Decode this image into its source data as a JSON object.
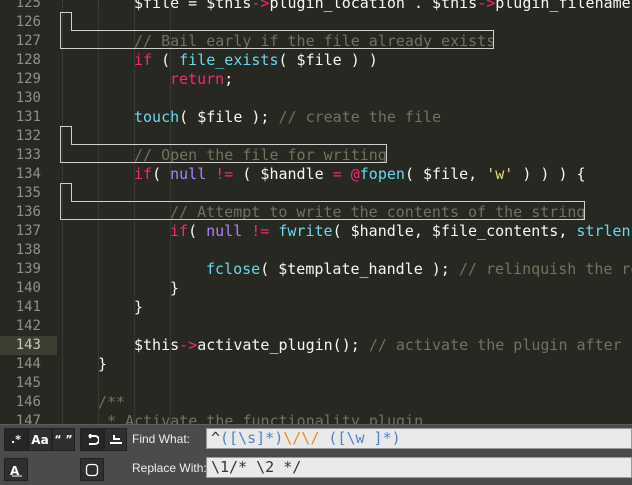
{
  "editor": {
    "first_line": 125,
    "current_line": 143,
    "colors": {
      "background": "#272822",
      "comment": "#75715e",
      "keyword": "#f92672",
      "function": "#66d9ef",
      "constant": "#ae81ff",
      "string": "#e6db74"
    },
    "lines": [
      {
        "n": "125",
        "indent": 2,
        "tokens": [
          [
            "tx",
            "$file = $this"
          ],
          [
            "op",
            "->"
          ],
          [
            "tx",
            "plugin_location . $this"
          ],
          [
            "op",
            "->"
          ],
          [
            "tx",
            "plugin_filename;"
          ]
        ]
      },
      {
        "n": "126",
        "indent": 0,
        "tokens": []
      },
      {
        "n": "127",
        "indent": 2,
        "tokens": [
          [
            "cm",
            "// Bail early if the file already exists"
          ]
        ]
      },
      {
        "n": "128",
        "indent": 2,
        "tokens": [
          [
            "kw",
            "if"
          ],
          [
            "tx",
            " ( "
          ],
          [
            "fn",
            "file_exists"
          ],
          [
            "tx",
            "( $file ) )"
          ]
        ]
      },
      {
        "n": "129",
        "indent": 3,
        "tokens": [
          [
            "kw",
            "return"
          ],
          [
            "tx",
            ";"
          ]
        ]
      },
      {
        "n": "130",
        "indent": 0,
        "tokens": []
      },
      {
        "n": "131",
        "indent": 2,
        "tokens": [
          [
            "fn",
            "touch"
          ],
          [
            "tx",
            "( $file ); "
          ],
          [
            "cm",
            "// create the file"
          ]
        ]
      },
      {
        "n": "132",
        "indent": 0,
        "tokens": []
      },
      {
        "n": "133",
        "indent": 2,
        "tokens": [
          [
            "cm",
            "// Open the file for writing"
          ]
        ]
      },
      {
        "n": "134",
        "indent": 2,
        "tokens": [
          [
            "kw",
            "if"
          ],
          [
            "tx",
            "( "
          ],
          [
            "c",
            "null"
          ],
          [
            "tx",
            " "
          ],
          [
            "op",
            "!="
          ],
          [
            "tx",
            " ( $handle "
          ],
          [
            "op",
            "="
          ],
          [
            "tx",
            " "
          ],
          [
            "op",
            "@"
          ],
          [
            "fn",
            "fopen"
          ],
          [
            "tx",
            "( $file, "
          ],
          [
            "str",
            "'w'"
          ],
          [
            "tx",
            " ) ) ) {"
          ]
        ]
      },
      {
        "n": "135",
        "indent": 0,
        "tokens": []
      },
      {
        "n": "136",
        "indent": 3,
        "tokens": [
          [
            "cm",
            "// Attempt to write the contents of the string"
          ]
        ]
      },
      {
        "n": "137",
        "indent": 3,
        "tokens": [
          [
            "kw",
            "if"
          ],
          [
            "tx",
            "( "
          ],
          [
            "c",
            "null"
          ],
          [
            "tx",
            " "
          ],
          [
            "op",
            "!="
          ],
          [
            "tx",
            " "
          ],
          [
            "fn",
            "fwrite"
          ],
          [
            "tx",
            "( $handle, $file_contents, "
          ],
          [
            "fn",
            "strlen"
          ],
          [
            "tx",
            "("
          ]
        ]
      },
      {
        "n": "138",
        "indent": 0,
        "tokens": []
      },
      {
        "n": "139",
        "indent": 4,
        "tokens": [
          [
            "fn",
            "fclose"
          ],
          [
            "tx",
            "( $template_handle ); "
          ],
          [
            "cm",
            "// relinquish the re"
          ]
        ]
      },
      {
        "n": "140",
        "indent": 3,
        "tokens": [
          [
            "tx",
            "}"
          ]
        ]
      },
      {
        "n": "141",
        "indent": 2,
        "tokens": [
          [
            "tx",
            "}"
          ]
        ]
      },
      {
        "n": "142",
        "indent": 0,
        "tokens": []
      },
      {
        "n": "143",
        "indent": 2,
        "tokens": [
          [
            "tx",
            "$this"
          ],
          [
            "op",
            "->"
          ],
          [
            "tx",
            "activate_plugin(); "
          ],
          [
            "cm",
            "// activate the plugin after c"
          ]
        ]
      },
      {
        "n": "144",
        "indent": 1,
        "tokens": [
          [
            "tx",
            "}"
          ]
        ]
      },
      {
        "n": "145",
        "indent": 0,
        "tokens": []
      },
      {
        "n": "146",
        "indent": 1,
        "tokens": [
          [
            "cm",
            "/**"
          ]
        ]
      },
      {
        "n": "147",
        "indent": 1,
        "tokens": [
          [
            "cm",
            " * Activate the functionality plugin"
          ]
        ]
      }
    ]
  },
  "find_panel": {
    "buttons": {
      "regex": ".*",
      "case": "Aa",
      "whole_word": "“ ”",
      "wrap": "wrap-icon",
      "in_selection": "in-selection-icon",
      "highlight": "highlight-icon",
      "preserve_case": "preserve-case-icon"
    },
    "find_label": "Find What:",
    "replace_label": "Replace With:",
    "find_value": {
      "p1": "^",
      "p2": "([\\s]*)",
      "p3": "\\/\\/",
      "p4": " ([\\w ]*)"
    },
    "replace_value": "\\1/* \\2 */"
  }
}
